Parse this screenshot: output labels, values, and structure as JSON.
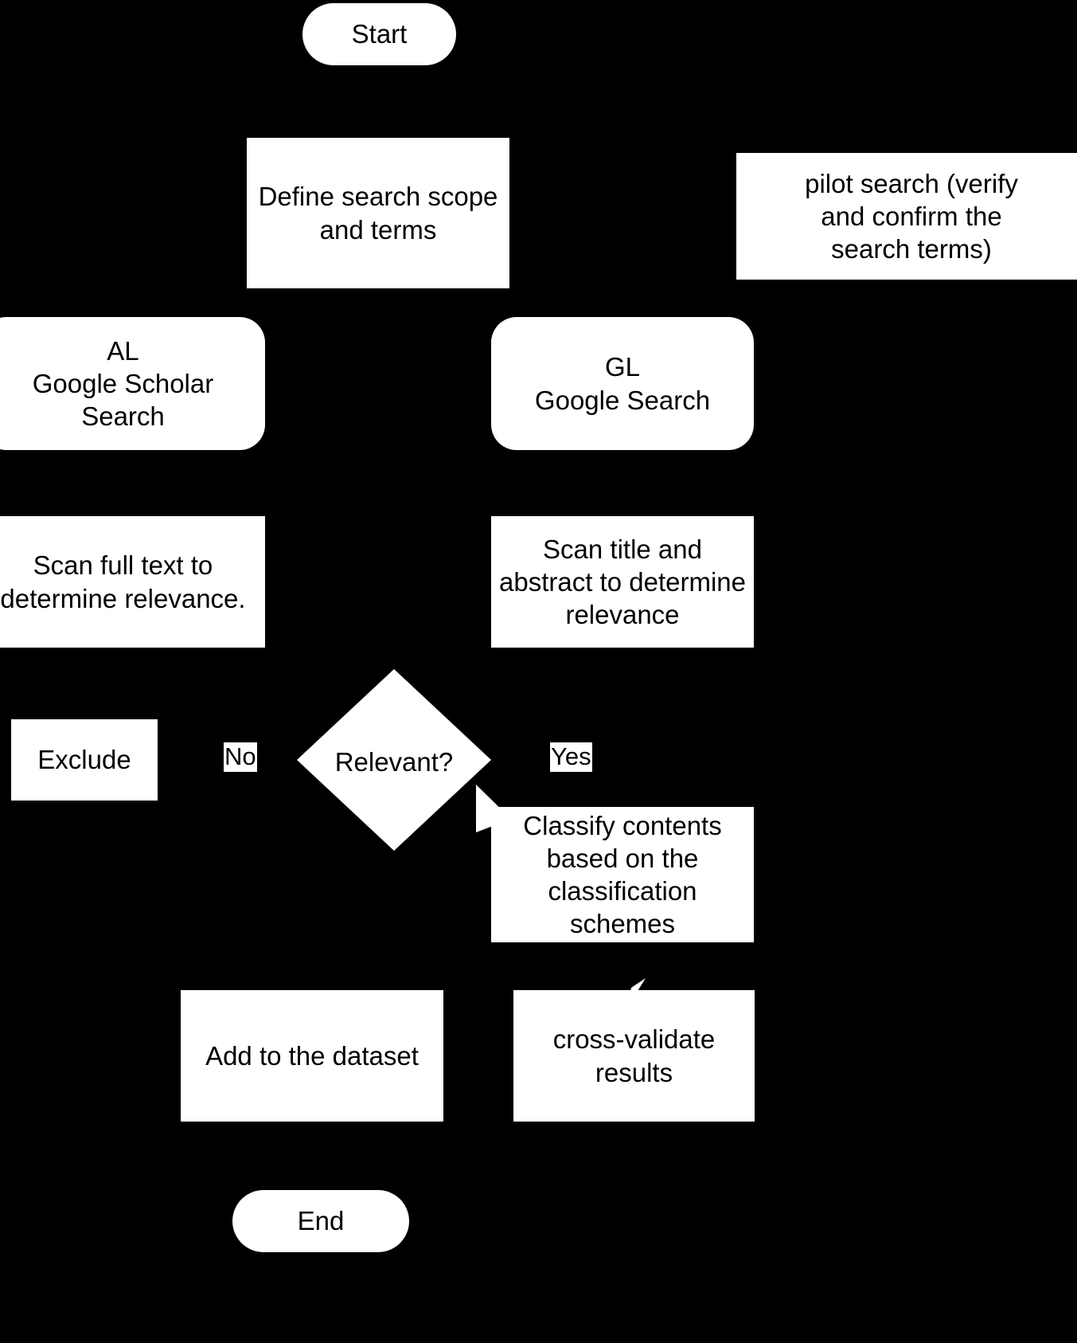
{
  "diagram": {
    "title": "Literature search and classification flowchart",
    "background_color": "#000000",
    "node_fill_color": "#ffffff",
    "text_color": "#000000"
  },
  "nodes": {
    "start": {
      "label": "Start",
      "shape": "stadium"
    },
    "define_scope": {
      "label": "Define search scope\nand terms",
      "shape": "rectangle"
    },
    "pilot_search": {
      "label": "pilot search (verify\nand confirm the\nsearch terms)",
      "shape": "rectangle"
    },
    "al_scholar": {
      "label": "AL\nGoogle Scholar\nSearch",
      "shape": "rounded-rectangle"
    },
    "gl_search": {
      "label": "GL\nGoogle Search",
      "shape": "rounded-rectangle"
    },
    "scan_full_text": {
      "label": "Scan full text to\ndetermine relevance.",
      "shape": "rectangle"
    },
    "scan_title_abstract": {
      "label": "Scan title and\nabstract to determine\nrelevance",
      "shape": "rectangle"
    },
    "relevant_decision": {
      "label": "Relevant?",
      "shape": "diamond"
    },
    "exclude": {
      "label": "Exclude",
      "shape": "rectangle"
    },
    "classify_contents": {
      "label": "Classify contents\nbased on the\nclassification\nschemes",
      "shape": "rectangle"
    },
    "add_to_dataset": {
      "label": "Add to the dataset",
      "shape": "rectangle"
    },
    "cross_validate": {
      "label": "cross-validate\nresults",
      "shape": "rectangle"
    },
    "end": {
      "label": "End",
      "shape": "stadium"
    }
  },
  "edge_labels": {
    "no": "No",
    "yes": "Yes"
  }
}
